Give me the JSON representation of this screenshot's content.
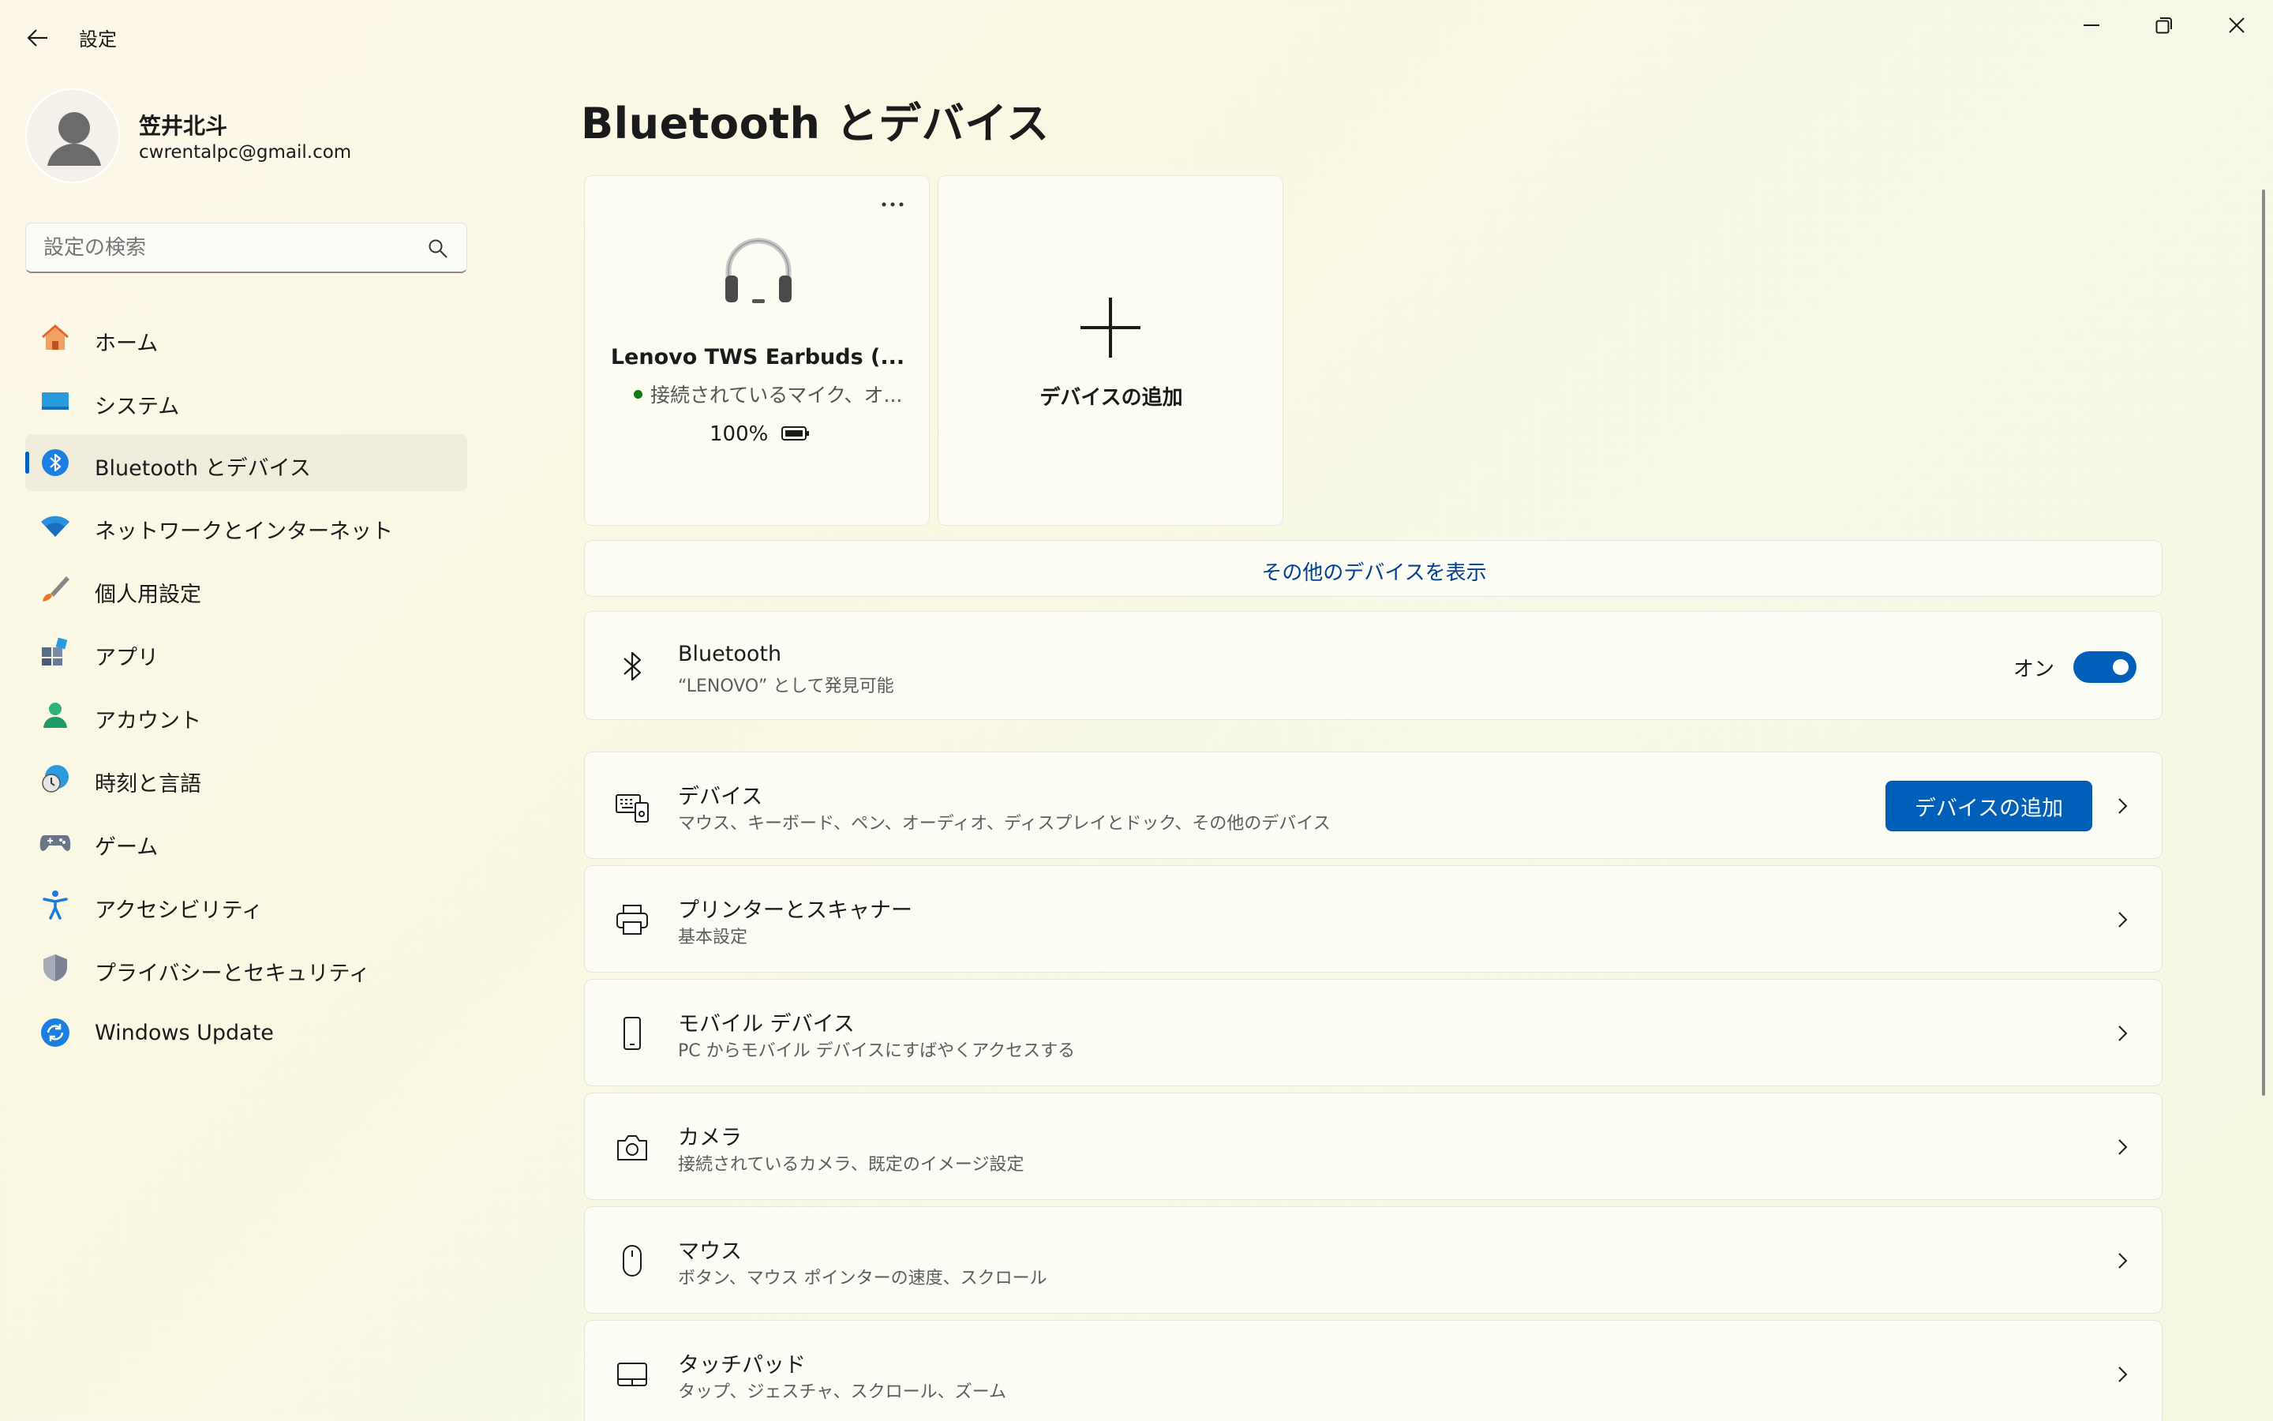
{
  "window": {
    "app_title": "設定",
    "icons": {
      "back": "back-arrow-icon",
      "minimize": "minimize-icon",
      "restore": "restore-icon",
      "close": "close-icon"
    }
  },
  "user": {
    "name": "笠井北斗",
    "email": "cwrentalpc@gmail.com"
  },
  "search": {
    "placeholder": "設定の検索"
  },
  "sidebar": {
    "items": [
      {
        "label": "ホーム",
        "icon": "home-icon"
      },
      {
        "label": "システム",
        "icon": "system-icon"
      },
      {
        "label": "Bluetooth とデバイス",
        "icon": "bluetooth-icon",
        "active": true
      },
      {
        "label": "ネットワークとインターネット",
        "icon": "wifi-icon"
      },
      {
        "label": "個人用設定",
        "icon": "brush-icon"
      },
      {
        "label": "アプリ",
        "icon": "apps-icon"
      },
      {
        "label": "アカウント",
        "icon": "account-icon"
      },
      {
        "label": "時刻と言語",
        "icon": "time-language-icon"
      },
      {
        "label": "ゲーム",
        "icon": "gamepad-icon"
      },
      {
        "label": "アクセシビリティ",
        "icon": "accessibility-icon"
      },
      {
        "label": "プライバシーとセキュリティ",
        "icon": "shield-icon"
      },
      {
        "label": "Windows Update",
        "icon": "update-icon"
      }
    ]
  },
  "main": {
    "title": "Bluetooth とデバイス",
    "device_card": {
      "name": "Lenovo TWS Earbuds (...",
      "status": "接続されているマイク、オ...",
      "battery": "100%",
      "status_color": "#107c10",
      "icon": "headphones-icon"
    },
    "add_card": {
      "label": "デバイスの追加",
      "icon": "plus-icon"
    },
    "view_more": "その他のデバイスを表示",
    "bluetooth_row": {
      "title": "Bluetooth",
      "subtitle": "“LENOVO” として発見可能",
      "toggle_label": "オン",
      "toggle_on": true
    },
    "settings_rows": [
      {
        "title": "デバイス",
        "subtitle": "マウス、キーボード、ペン、オーディオ、ディスプレイとドック、その他のデバイス",
        "icon": "devices-icon",
        "button": "デバイスの追加"
      },
      {
        "title": "プリンターとスキャナー",
        "subtitle": "基本設定",
        "icon": "printer-icon"
      },
      {
        "title": "モバイル デバイス",
        "subtitle": "PC からモバイル デバイスにすばやくアクセスする",
        "icon": "phone-icon"
      },
      {
        "title": "カメラ",
        "subtitle": "接続されているカメラ、既定のイメージ設定",
        "icon": "camera-icon"
      },
      {
        "title": "マウス",
        "subtitle": "ボタン、マウス ポインターの速度、スクロール",
        "icon": "mouse-icon"
      },
      {
        "title": "タッチパッド",
        "subtitle": "タップ、ジェスチャ、スクロール、ズーム",
        "icon": "touchpad-icon"
      }
    ]
  },
  "colors": {
    "accent": "#005fb8",
    "link": "#003e92"
  }
}
